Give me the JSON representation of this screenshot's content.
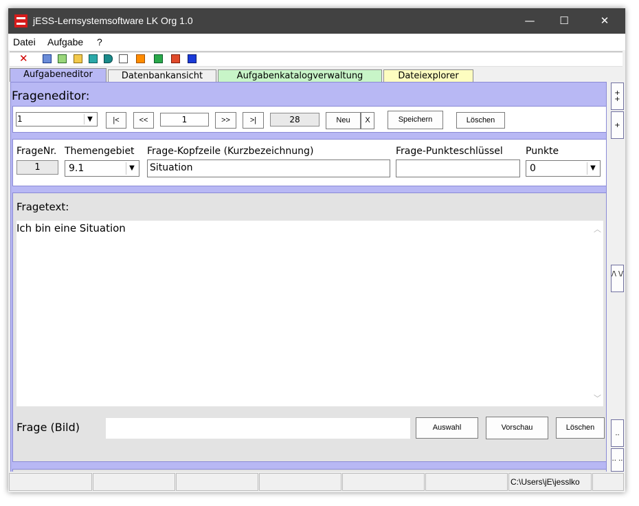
{
  "window": {
    "title": "jESS-Lernsystemsoftware LK Org 1.0",
    "minimize": "—",
    "maximize": "☐",
    "close": "✕"
  },
  "menu": [
    "Datei",
    "Aufgabe",
    "?"
  ],
  "toolbar": {
    "delete_glyph": "✕"
  },
  "tabs": [
    "Aufgabeneditor",
    "Datenbankansicht",
    "Aufgabenkatalogverwaltung",
    "Dateiexplorer"
  ],
  "frageneditor": {
    "title": "Frageneditor:",
    "select_value": "1",
    "nav_first": "|<",
    "nav_prev": "<<",
    "current": "1",
    "nav_next": ">>",
    "nav_last": ">|",
    "total": "28",
    "neu": "Neu",
    "x": "X",
    "speichern": "Speichern",
    "loeschen": "Löschen"
  },
  "fields": {
    "frage_nr_label": "FrageNr.",
    "frage_nr_value": "1",
    "themengebiet_label": "Themengebiet",
    "themengebiet_value": "9.1",
    "kopfzeile_label": "Frage-Kopfzeile (Kurzbezeichnung)",
    "kopfzeile_value": "Situation",
    "punkteschluessel_label": "Frage-Punkteschlüssel",
    "punkteschluessel_value": "",
    "punkte_label": "Punkte",
    "punkte_value": "0"
  },
  "fragetext": {
    "label": "Fragetext:",
    "content": "Ich bin eine Situation",
    "bild_label": "Frage (Bild)",
    "bild_value": "",
    "auswahl": "Auswahl",
    "vorschau": "Vorschau",
    "loeschen": "Löschen"
  },
  "side_buttons": {
    "plus_plus": "+ +",
    "plus": "+",
    "toggle": "/\\ \\/",
    "minus": "..",
    "minus_minus": ".. .."
  },
  "statusbar": {
    "path": "C:\\Users\\jE\\jesslko"
  },
  "icons": [
    "delete-icon",
    "doc-blue-icon",
    "doc-green-icon",
    "doc-yellow-icon",
    "doc-teal-icon",
    "folder-icon",
    "doc-white-icon",
    "e-icon",
    "image-icon",
    "puzzle-icon",
    "exit-icon",
    "chevron-down-icon",
    "scroll-up-icon",
    "scroll-down-icon"
  ],
  "colors": {
    "panel": "#b8b8f4",
    "tab_active": "#b8b8f4",
    "tab_green": "#c8f5c8",
    "tab_yellow": "#fdfdc0",
    "title_bar": "#424242"
  }
}
